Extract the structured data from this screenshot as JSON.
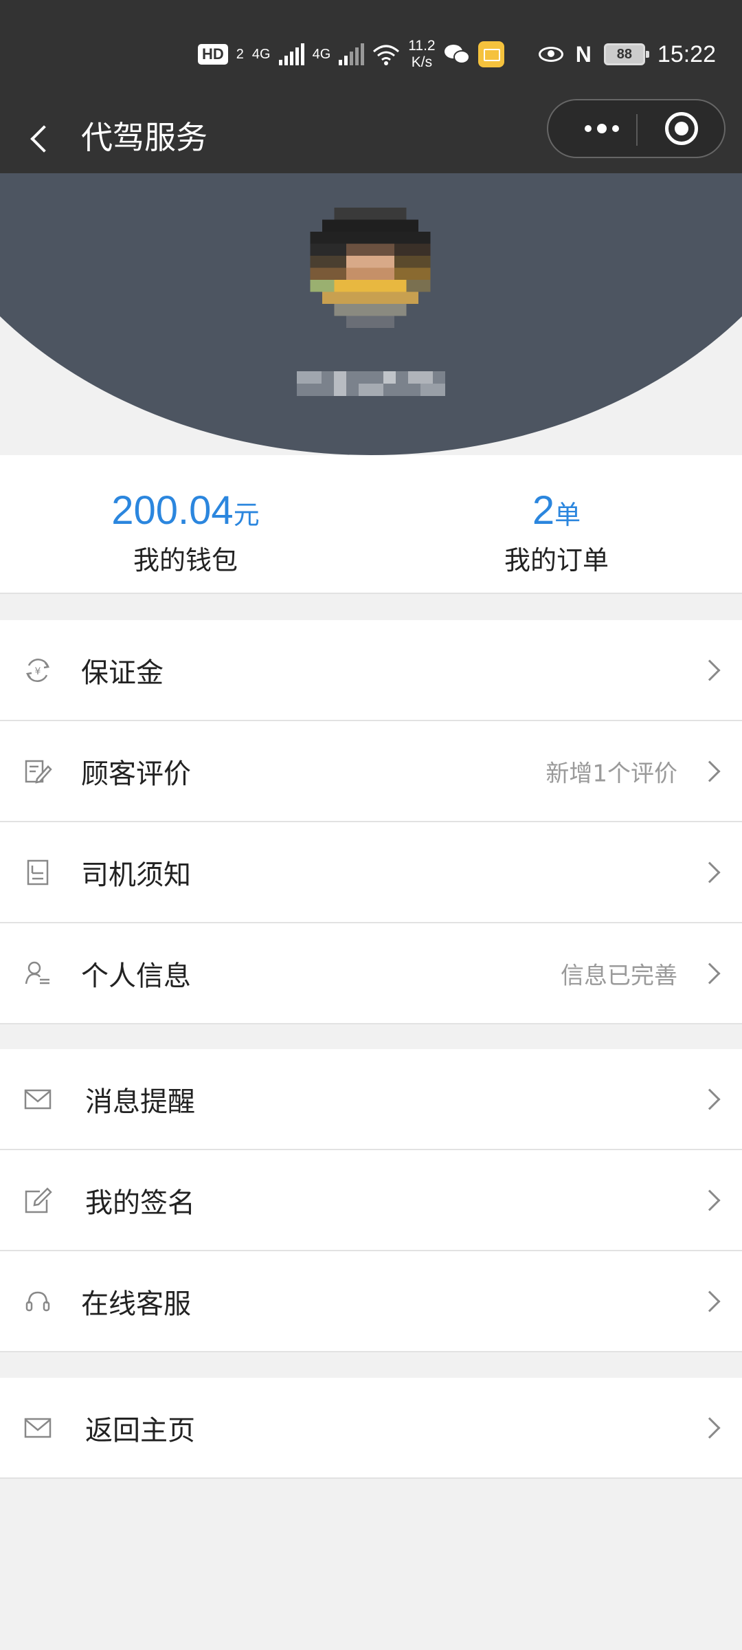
{
  "status_bar": {
    "hd": "HD",
    "sim": "2",
    "net1": "4G",
    "net2": "4G",
    "speed_value": "11.2",
    "speed_unit": "K/s",
    "battery": "88",
    "time": "15:22"
  },
  "nav": {
    "title": "代驾服务"
  },
  "stats": {
    "wallet": {
      "value": "200.04",
      "unit": "元",
      "label": "我的钱包"
    },
    "orders": {
      "value": "2",
      "unit": "单",
      "label": "我的订单"
    }
  },
  "menu_groups": [
    [
      {
        "label": "保证金",
        "hint": "",
        "icon": "deposit-icon"
      },
      {
        "label": "顾客评价",
        "hint": "新增1个评价",
        "icon": "review-icon"
      },
      {
        "label": "司机须知",
        "hint": "",
        "icon": "notice-icon"
      },
      {
        "label": "个人信息",
        "hint": "信息已完善",
        "icon": "profile-icon"
      }
    ],
    [
      {
        "label": "消息提醒",
        "hint": "",
        "icon": "mail-icon"
      },
      {
        "label": "我的签名",
        "hint": "",
        "icon": "signature-icon"
      },
      {
        "label": "在线客服",
        "hint": "",
        "icon": "headset-icon"
      }
    ],
    [
      {
        "label": "返回主页",
        "hint": "",
        "icon": "mail-icon"
      }
    ]
  ],
  "colors": {
    "accent": "#2b86de",
    "header_bg": "#4d5561",
    "bar_bg": "#333333"
  }
}
